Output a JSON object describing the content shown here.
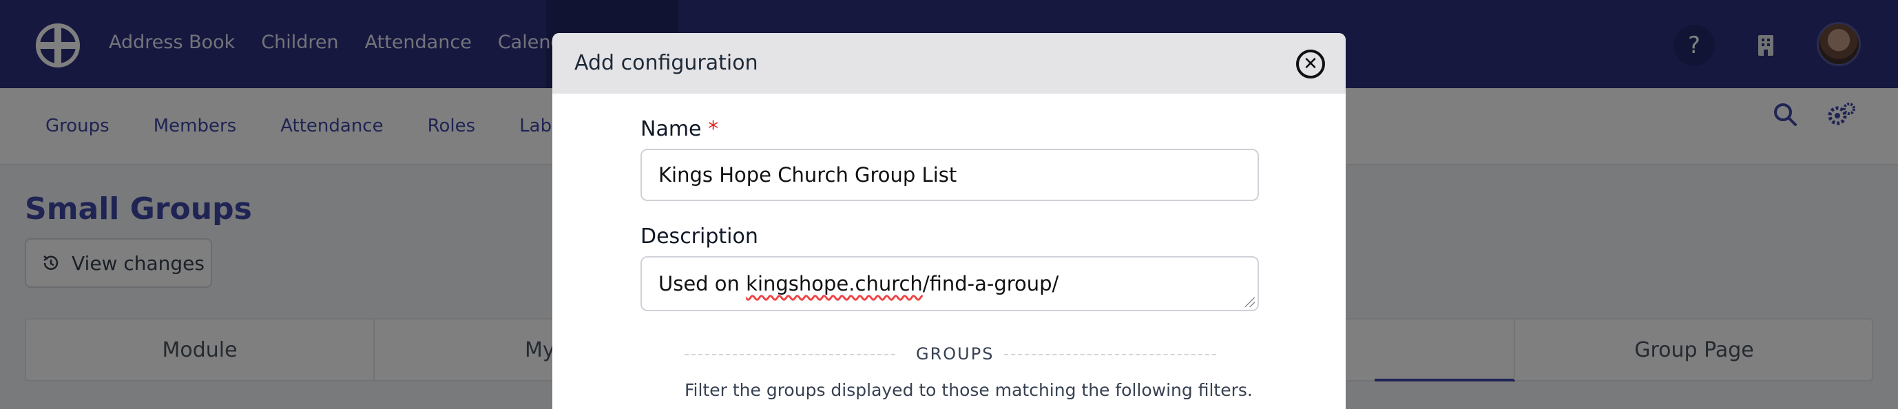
{
  "topnav": {
    "items": [
      "Address Book",
      "Children",
      "Attendance",
      "Calendar"
    ]
  },
  "subnav": {
    "items": [
      "Groups",
      "Members",
      "Attendance",
      "Roles",
      "Labels"
    ]
  },
  "page": {
    "title": "Small Groups",
    "view_changes_label": "View changes",
    "tabs": [
      "Module",
      "My G",
      "",
      "Group Page"
    ]
  },
  "modal": {
    "title": "Add configuration",
    "name_label": "Name",
    "required_mark": "*",
    "name_value": "Kings Hope Church Group List",
    "description_label": "Description",
    "description_prefix": "Used on ",
    "description_link": "kingshope.church",
    "description_suffix": "/find-a-group/",
    "groups_section_title": "GROUPS",
    "groups_section_desc": "Filter the groups displayed to those matching the following filters."
  },
  "icons": {
    "help": "question-circle-icon",
    "building": "building-icon",
    "search": "search-icon",
    "settings": "gear-icon",
    "history": "history-icon",
    "close": "close-icon"
  },
  "colors": {
    "brand": "#2c3181",
    "accent": "#3f48a8",
    "required": "#dc2626"
  }
}
